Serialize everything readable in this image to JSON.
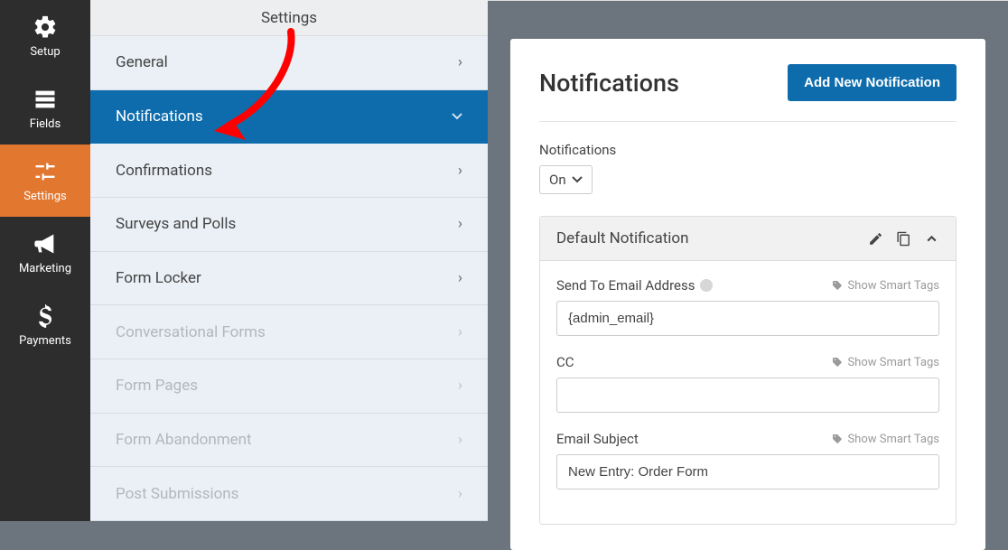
{
  "sidebar": {
    "items": [
      {
        "label": "Setup"
      },
      {
        "label": "Fields"
      },
      {
        "label": "Settings"
      },
      {
        "label": "Marketing"
      },
      {
        "label": "Payments"
      }
    ]
  },
  "page_title": "Settings",
  "settings_menu": {
    "items": [
      {
        "label": "General",
        "muted": false,
        "active": false,
        "caret": "right"
      },
      {
        "label": "Notifications",
        "muted": false,
        "active": true,
        "caret": "down"
      },
      {
        "label": "Confirmations",
        "muted": false,
        "active": false,
        "caret": "right"
      },
      {
        "label": "Surveys and Polls",
        "muted": false,
        "active": false,
        "caret": "right"
      },
      {
        "label": "Form Locker",
        "muted": false,
        "active": false,
        "caret": "right"
      },
      {
        "label": "Conversational Forms",
        "muted": true,
        "active": false,
        "caret": "right"
      },
      {
        "label": "Form Pages",
        "muted": true,
        "active": false,
        "caret": "right"
      },
      {
        "label": "Form Abandonment",
        "muted": true,
        "active": false,
        "caret": "right"
      },
      {
        "label": "Post Submissions",
        "muted": true,
        "active": false,
        "caret": "right"
      }
    ]
  },
  "panel": {
    "heading": "Notifications",
    "add_button": "Add New Notification",
    "toggle_label": "Notifications",
    "toggle_value": "On",
    "card": {
      "title": "Default Notification",
      "smart_tags_label": "Show Smart Tags",
      "fields": {
        "send_to": {
          "label": "Send To Email Address",
          "value": "{admin_email}"
        },
        "cc": {
          "label": "CC",
          "value": ""
        },
        "subject": {
          "label": "Email Subject",
          "value": "New Entry: Order Form"
        }
      }
    }
  },
  "colors": {
    "accent": "#e27730",
    "primary": "#0e6cad"
  }
}
